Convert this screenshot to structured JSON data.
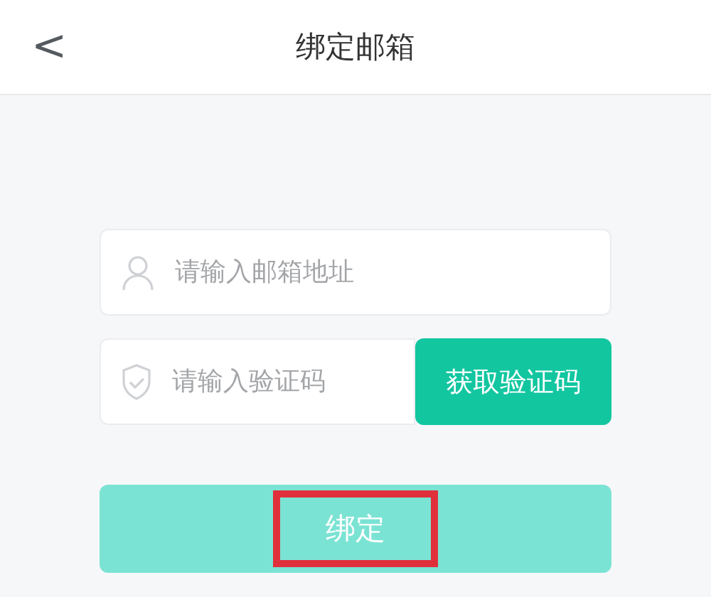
{
  "header": {
    "back_icon": "<",
    "title": "绑定邮箱"
  },
  "email_field": {
    "placeholder": "请输入邮箱地址"
  },
  "code_field": {
    "placeholder": "请输入验证码"
  },
  "get_code_button": {
    "label": "获取验证码"
  },
  "bind_button": {
    "label": "绑定",
    "disabled": true,
    "highlighted": true
  }
}
